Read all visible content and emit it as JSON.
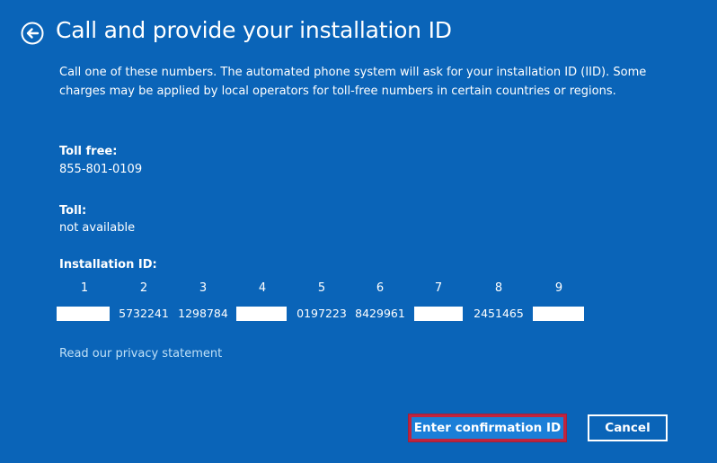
{
  "header": {
    "back_icon": "back-arrow-circle-icon",
    "title": "Call and provide your installation ID"
  },
  "description": "Call one of these numbers. The automated phone system will ask for your installation ID (IID). Some charges may be applied by local operators for toll-free numbers in certain countries or regions.",
  "toll_free": {
    "label": "Toll free:",
    "value": "855-801-0109"
  },
  "toll": {
    "label": "Toll:",
    "value": "not available"
  },
  "installation_id": {
    "label": "Installation ID:",
    "groups": [
      {
        "number": "1",
        "value": "",
        "redacted": true
      },
      {
        "number": "2",
        "value": "5732241",
        "redacted": false
      },
      {
        "number": "3",
        "value": "1298784",
        "redacted": false
      },
      {
        "number": "4",
        "value": "",
        "redacted": true
      },
      {
        "number": "5",
        "value": "0197223",
        "redacted": false
      },
      {
        "number": "6",
        "value": "8429961",
        "redacted": false
      },
      {
        "number": "7",
        "value": "",
        "redacted": true
      },
      {
        "number": "8",
        "value": "2451465",
        "redacted": false
      },
      {
        "number": "9",
        "value": "",
        "redacted": true
      }
    ]
  },
  "privacy_link": "Read our privacy statement",
  "buttons": {
    "primary": "Enter confirmation ID",
    "secondary": "Cancel"
  },
  "colors": {
    "background": "#0a64b8",
    "primary_button": "#1b7fd8",
    "highlight_border": "#c0243e",
    "link": "#bfe0f7"
  }
}
